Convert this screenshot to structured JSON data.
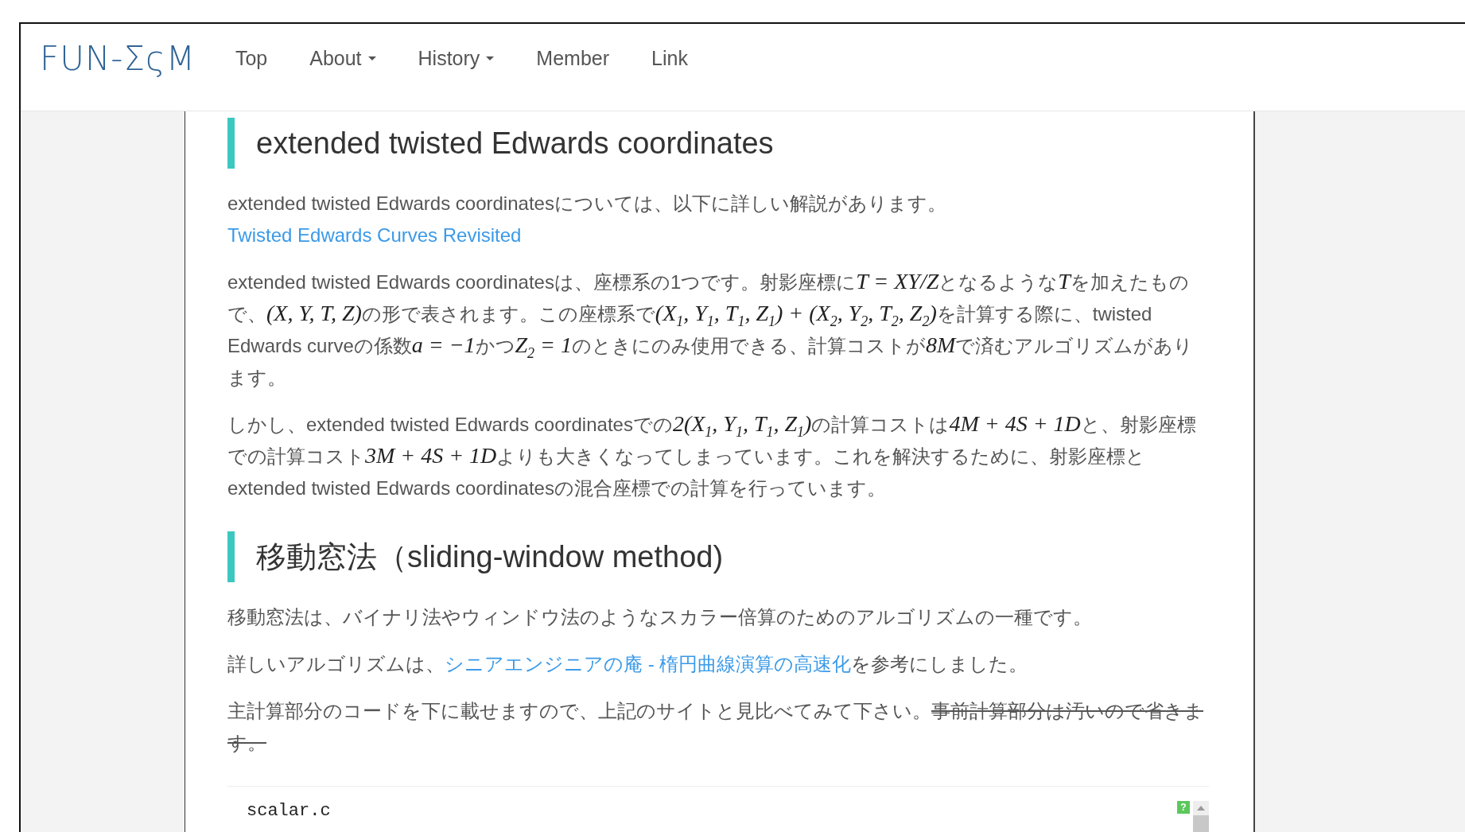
{
  "header": {
    "logo": "FUN-ΣςM",
    "menu": [
      {
        "label": "Top",
        "dropdown": false
      },
      {
        "label": "About",
        "dropdown": true
      },
      {
        "label": "History",
        "dropdown": true
      },
      {
        "label": "Member",
        "dropdown": false
      },
      {
        "label": "Link",
        "dropdown": false
      }
    ]
  },
  "sections": [
    {
      "heading": "extended twisted Edwards coordinates",
      "paragraphs": [
        [
          {
            "kind": "text",
            "text": "extended twisted Edwards coordinatesについては、以下に詳しい解説があります。"
          },
          {
            "kind": "break"
          },
          {
            "kind": "link",
            "text": "Twisted Edwards Curves Revisited"
          }
        ],
        [
          {
            "kind": "text",
            "text": "extended twisted Edwards coordinatesは、座標系の1つです。射影座標に"
          },
          {
            "kind": "math",
            "text": "T = XY/Z"
          },
          {
            "kind": "text",
            "text": "となるような"
          },
          {
            "kind": "math",
            "text": "T"
          },
          {
            "kind": "text",
            "text": "を加えたもので、"
          },
          {
            "kind": "math",
            "text": "(X, Y, T, Z)"
          },
          {
            "kind": "text",
            "text": "の形で表されます。この座標系で"
          },
          {
            "kind": "math",
            "text": "(X$_{1}$, Y$_{1}$, T$_{1}$, Z$_{1}$) + (X$_{2}$, Y$_{2}$, T$_{2}$, Z$_{2}$)"
          },
          {
            "kind": "text",
            "text": "を計算する際に、twisted Edwards curveの係数"
          },
          {
            "kind": "math",
            "text": "a = −1"
          },
          {
            "kind": "text",
            "text": "かつ"
          },
          {
            "kind": "math",
            "text": "Z$_{2}$ = 1"
          },
          {
            "kind": "text",
            "text": "のときにのみ使用できる、計算コストが"
          },
          {
            "kind": "math",
            "text": "8M"
          },
          {
            "kind": "text",
            "text": "で済むアルゴリズムがあります。"
          }
        ],
        [
          {
            "kind": "text",
            "text": "しかし、extended twisted Edwards coordinatesでの"
          },
          {
            "kind": "math",
            "text": "2(X$_{1}$, Y$_{1}$, T$_{1}$, Z$_{1}$)"
          },
          {
            "kind": "text",
            "text": "の計算コストは"
          },
          {
            "kind": "math",
            "text": "4M + 4S + 1D"
          },
          {
            "kind": "text",
            "text": "と、射影座標での計算コスト"
          },
          {
            "kind": "math",
            "text": "3M + 4S + 1D"
          },
          {
            "kind": "text",
            "text": "よりも大きくなってしまっています。これを解決するために、射影座標とextended twisted Edwards coordinatesの混合座標での計算を行っています。"
          }
        ]
      ]
    },
    {
      "heading": "移動窓法（sliding-window method)",
      "paragraphs": [
        [
          {
            "kind": "text",
            "text": "移動窓法は、バイナリ法やウィンドウ法のようなスカラー倍算のためのアルゴリズムの一種です。"
          }
        ],
        [
          {
            "kind": "text",
            "text": "詳しいアルゴリズムは、"
          },
          {
            "kind": "link",
            "text": "シニアエンジニアの庵 - 楕円曲線演算の高速化"
          },
          {
            "kind": "text",
            "text": "を参考にしました。"
          }
        ],
        [
          {
            "kind": "text",
            "text": "主計算部分のコードを下に載せますので、上記のサイトと見比べてみて下さい。"
          },
          {
            "kind": "strike",
            "text": "事前計算部分は汚いので省きます。"
          }
        ]
      ]
    }
  ],
  "code": {
    "filename": "scalar.c",
    "help_badge": "?"
  }
}
